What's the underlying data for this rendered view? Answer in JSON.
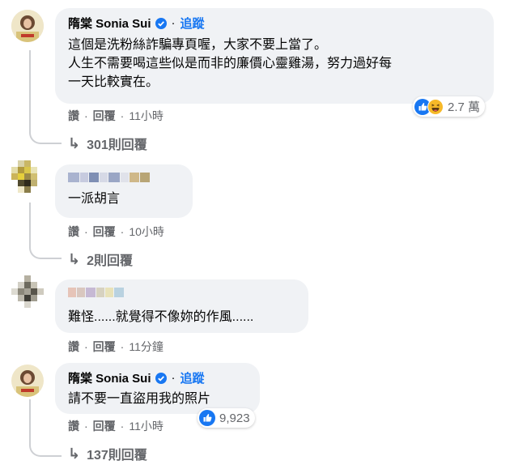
{
  "colors": {
    "bubble": "#f0f2f5",
    "secondary_text": "#65676b",
    "follow_blue": "#1877f2",
    "verified_blue": "#1877f2",
    "like_blue": "#1877f2",
    "haha_yellow": "#f7b928"
  },
  "comments": [
    {
      "author": "隋棠 Sonia Sui",
      "verified": true,
      "follow_label": "追蹤",
      "lines": [
        "這個是洗粉絲詐騙專頁喔，大家不要上當了。",
        "人生不需要喝這些似是而非的廉價心靈雞湯，努力過好每",
        "一天比較實在。"
      ],
      "like_label": "讚",
      "reply_label": "回覆",
      "time": "11小時",
      "reaction_icons": [
        "like-icon",
        "haha-icon"
      ],
      "reaction_count": "2.7 萬",
      "replies_label": "301則回覆"
    },
    {
      "author": "",
      "author_blurred": true,
      "lines": [
        "一派胡言"
      ],
      "like_label": "讚",
      "reply_label": "回覆",
      "time": "10小時",
      "replies_label": "2則回覆"
    },
    {
      "author": "",
      "author_blurred": true,
      "lines": [
        "難怪......就覺得不像妳的作風......"
      ],
      "like_label": "讚",
      "reply_label": "回覆",
      "time": "11分鐘"
    },
    {
      "author": "隋棠 Sonia Sui",
      "verified": true,
      "follow_label": "追蹤",
      "lines": [
        "請不要一直盜用我的照片"
      ],
      "like_label": "讚",
      "reply_label": "回覆",
      "time": "11小時",
      "reaction_icons": [
        "like-icon"
      ],
      "reaction_count": "9,923",
      "replies_label": "137則回覆"
    }
  ]
}
